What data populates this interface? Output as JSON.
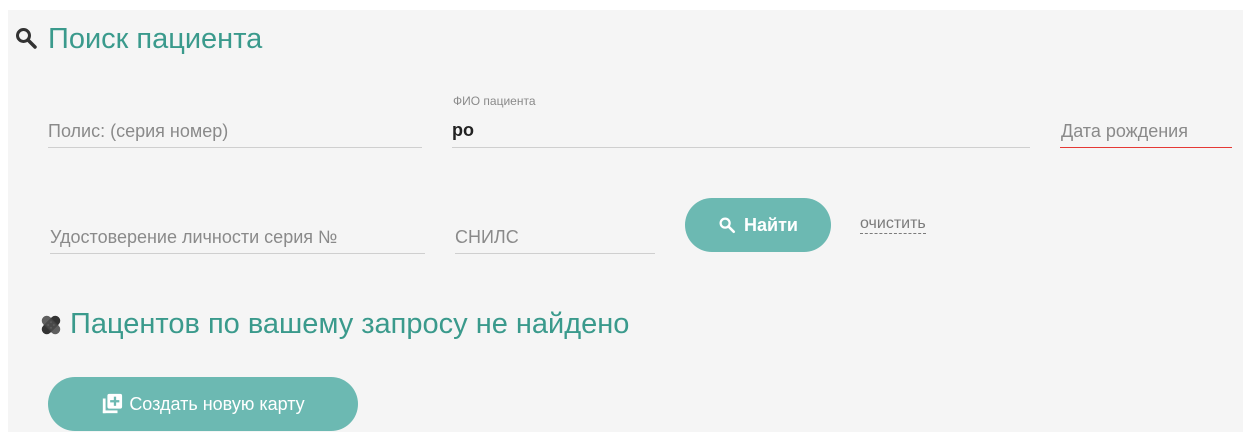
{
  "search": {
    "title": "Поиск пациента",
    "policy_placeholder": "Полис: (серия номер)",
    "fio_label": "ФИО пациента",
    "fio_value": "ро",
    "birthdate_placeholder": "Дата рождения",
    "id_doc_placeholder": "Удостоверение личности серия №",
    "snils_placeholder": "СНИЛС",
    "find_button": "Найти",
    "clear_link": "очистить"
  },
  "result": {
    "message": "Пацентов по вашему запросу не найдено",
    "create_button": "Создать новую карту"
  },
  "colors": {
    "accent": "#3a9a8c",
    "button": "#6cb9b2",
    "error_underline": "#e53935"
  },
  "icons": {
    "search": "search-icon",
    "not_found": "bandage-icon",
    "add_card": "add-card-icon"
  }
}
